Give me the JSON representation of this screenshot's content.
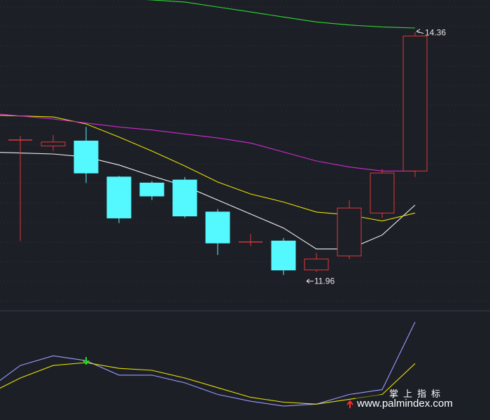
{
  "colors": {
    "background": "#1c1f26",
    "up_candle": "#e0383b",
    "down_candle": "#54f8ff",
    "ma_white": "#f2f2f2",
    "ma_yellow": "#e8e000",
    "ma_magenta": "#d22cd2",
    "ma_green": "#31d931",
    "grid": "#3a3f4a",
    "osc_fast": "#9a9cff",
    "osc_slow": "#e8e000",
    "buy_arrow": "#ff2a2a",
    "sell_arrow": "#18e018"
  },
  "chart_data": {
    "type": "candlestick",
    "price_ylim": [
      11.6,
      14.68
    ],
    "candles": [
      {
        "open": 13.28,
        "high": 13.32,
        "low": 12.27,
        "close": 13.28
      },
      {
        "open": 13.22,
        "high": 13.33,
        "low": 13.17,
        "close": 13.26
      },
      {
        "open": 13.27,
        "high": 13.41,
        "low": 12.85,
        "close": 12.95
      },
      {
        "open": 12.91,
        "high": 12.92,
        "low": 12.45,
        "close": 12.5
      },
      {
        "open": 12.85,
        "high": 12.87,
        "low": 12.68,
        "close": 12.72
      },
      {
        "open": 12.88,
        "high": 12.91,
        "low": 12.5,
        "close": 12.52
      },
      {
        "open": 12.56,
        "high": 12.59,
        "low": 12.13,
        "close": 12.25
      },
      {
        "open": 12.26,
        "high": 12.34,
        "low": 12.22,
        "close": 12.26
      },
      {
        "open": 12.27,
        "high": 12.3,
        "low": 11.93,
        "close": 11.98
      },
      {
        "open": 11.98,
        "high": 12.15,
        "low": 11.96,
        "close": 12.09
      },
      {
        "open": 12.12,
        "high": 12.68,
        "low": 12.09,
        "close": 12.6
      },
      {
        "open": 12.55,
        "high": 12.99,
        "low": 12.5,
        "close": 12.95
      },
      {
        "open": 12.97,
        "high": 14.36,
        "low": 12.91,
        "close": 14.32
      }
    ],
    "ma_series": [
      {
        "key": "white",
        "values": [
          13.15,
          13.14,
          13.11,
          13.03,
          12.92,
          12.82,
          12.68,
          12.54,
          12.4,
          12.19,
          12.19,
          12.33,
          12.63
        ]
      },
      {
        "key": "yellow",
        "values": [
          13.52,
          13.51,
          13.44,
          13.31,
          13.17,
          13.02,
          12.86,
          12.74,
          12.66,
          12.56,
          12.53,
          12.47,
          12.55
        ]
      },
      {
        "key": "magenta",
        "values": [
          13.52,
          13.49,
          13.45,
          13.41,
          13.38,
          13.34,
          13.3,
          13.25,
          13.16,
          13.07,
          13.01,
          12.97,
          12.97
        ]
      },
      {
        "key": "green",
        "values": [
          14.73,
          14.72,
          14.71,
          14.7,
          14.68,
          14.66,
          14.61,
          14.56,
          14.51,
          14.46,
          14.43,
          14.41,
          14.4
        ]
      }
    ],
    "annotations": [
      {
        "text": "14.36",
        "candle_index": 12,
        "value": 14.36,
        "side": "above"
      },
      {
        "text": "11.96",
        "candle_index": 9,
        "value": 11.96,
        "side": "below"
      }
    ],
    "oscillator": {
      "ylim": [
        0,
        100
      ],
      "fast": [
        30,
        55,
        65,
        60,
        45,
        45,
        37,
        25,
        18,
        13,
        15,
        25,
        30,
        100
      ],
      "slow": [
        25,
        42,
        55,
        58,
        52,
        50,
        42,
        32,
        22,
        17,
        15,
        20,
        25,
        57
      ],
      "signals": [
        {
          "index": 3,
          "kind": "sell",
          "value": 58
        },
        {
          "index": 11,
          "kind": "buy",
          "value": 18
        }
      ]
    },
    "grid": true
  },
  "watermark": {
    "cn": "掌上指标",
    "url": "www.palmindex.com"
  }
}
